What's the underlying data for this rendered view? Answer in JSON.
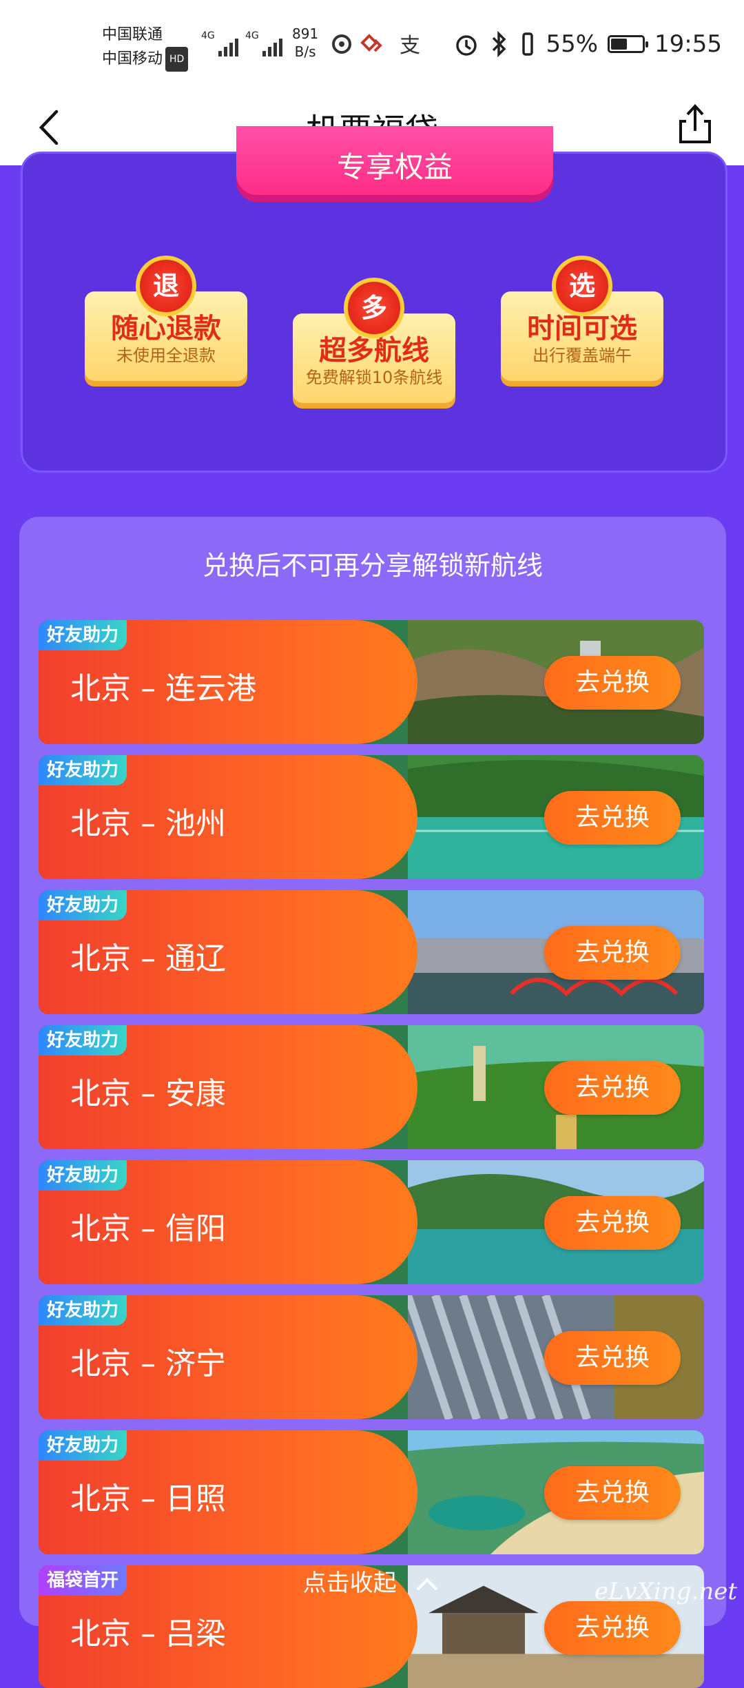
{
  "status_bar": {
    "carrier_1": "中国联通",
    "carrier_2": "中国移动",
    "hd_badge": "HD",
    "network_1": "4G",
    "network_2": "4G",
    "speed_value": "891",
    "speed_unit": "B/s",
    "battery_percent": "55%",
    "battery_level": 0.55,
    "time": "19:55"
  },
  "header": {
    "title": "机票福袋"
  },
  "banner": {
    "label": "专享权益"
  },
  "perks": [
    {
      "badge": "退",
      "title": "随心退款",
      "subtitle": "未使用全退款"
    },
    {
      "badge": "多",
      "title": "超多航线",
      "subtitle": "免费解锁10条航线"
    },
    {
      "badge": "选",
      "title": "时间可选",
      "subtitle": "出行覆盖端午"
    }
  ],
  "card": {
    "title": "兑换后不可再分享解锁新航线"
  },
  "routes": [
    {
      "tag": "好友助力",
      "route": "北京 – 连云港",
      "button": "去兑换"
    },
    {
      "tag": "好友助力",
      "route": "北京 – 池州",
      "button": "去兑换"
    },
    {
      "tag": "好友助力",
      "route": "北京 – 通辽",
      "button": "去兑换"
    },
    {
      "tag": "好友助力",
      "route": "北京 – 安康",
      "button": "去兑换"
    },
    {
      "tag": "好友助力",
      "route": "北京 – 信阳",
      "button": "去兑换"
    },
    {
      "tag": "好友助力",
      "route": "北京 – 济宁",
      "button": "去兑换"
    },
    {
      "tag": "好友助力",
      "route": "北京 – 日照",
      "button": "去兑换"
    },
    {
      "tag": "福袋首开",
      "route": "北京 – 吕梁",
      "button": "去兑换"
    }
  ],
  "collapse_label": "点击收起",
  "watermark": "eLvXing.net",
  "colors": {
    "background": "#6b3cf2",
    "card": "#8d69f8",
    "route_gradient_start": "#f23f2d",
    "route_gradient_end": "#ff7a1b",
    "tag_blue": "#2f86ff",
    "tag_purple": "#b13fff"
  },
  "icons": {
    "back": "back-arrow-icon",
    "share": "share-icon",
    "collapse": "chevron-up-icon"
  }
}
